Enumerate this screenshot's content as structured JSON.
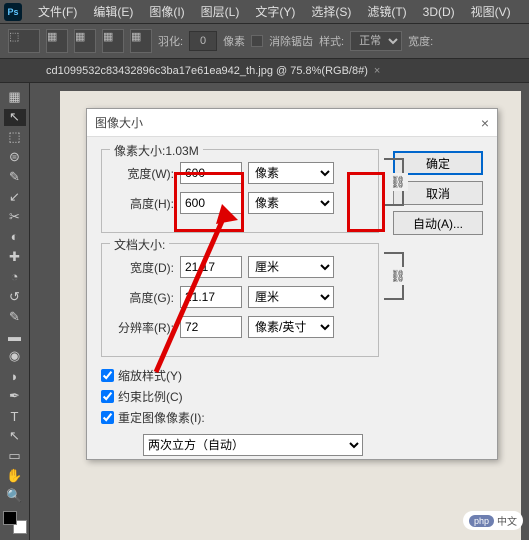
{
  "menu": [
    "文件(F)",
    "编辑(E)",
    "图像(I)",
    "图层(L)",
    "文字(Y)",
    "选择(S)",
    "滤镜(T)",
    "3D(D)",
    "视图(V)"
  ],
  "opts": {
    "feather_label": "羽化:",
    "feather_val": "0",
    "feather_unit": "像素",
    "antialias": "消除锯齿",
    "style_label": "样式:",
    "style_val": "正常",
    "width_label": "宽度:"
  },
  "tab": {
    "title": "cd1099532c83432896c3ba17e61ea942_th.jpg @ 75.8%(RGB/8#)",
    "close": "×"
  },
  "tools": [
    "▦",
    "↖",
    "⬚",
    "⊜",
    "✎",
    "↙",
    "✂",
    "◐",
    "✚",
    "◔",
    "↺",
    "✎",
    "T",
    "↖",
    "✋",
    "🔍"
  ],
  "dialog": {
    "title": "图像大小",
    "close": "×",
    "ok": "确定",
    "cancel": "取消",
    "auto": "自动(A)...",
    "px_label": "像素大小:1.03M",
    "w_label": "宽度(W):",
    "h_label": "高度(H):",
    "w_val": "600",
    "h_val": "600",
    "unit_px": "像素",
    "doc_label": "文档大小:",
    "dw_label": "宽度(D):",
    "dh_label": "高度(G):",
    "res_label": "分辨率(R):",
    "dw_val": "21.17",
    "dh_val": "21.17",
    "res_val": "72",
    "unit_cm": "厘米",
    "unit_res": "像素/英寸",
    "chk1": "缩放样式(Y)",
    "chk2": "约束比例(C)",
    "chk3": "重定图像像素(I):",
    "interp": "两次立方（自动）",
    "link": "⛓"
  },
  "branding": {
    "php": "php",
    "text": "中文"
  }
}
